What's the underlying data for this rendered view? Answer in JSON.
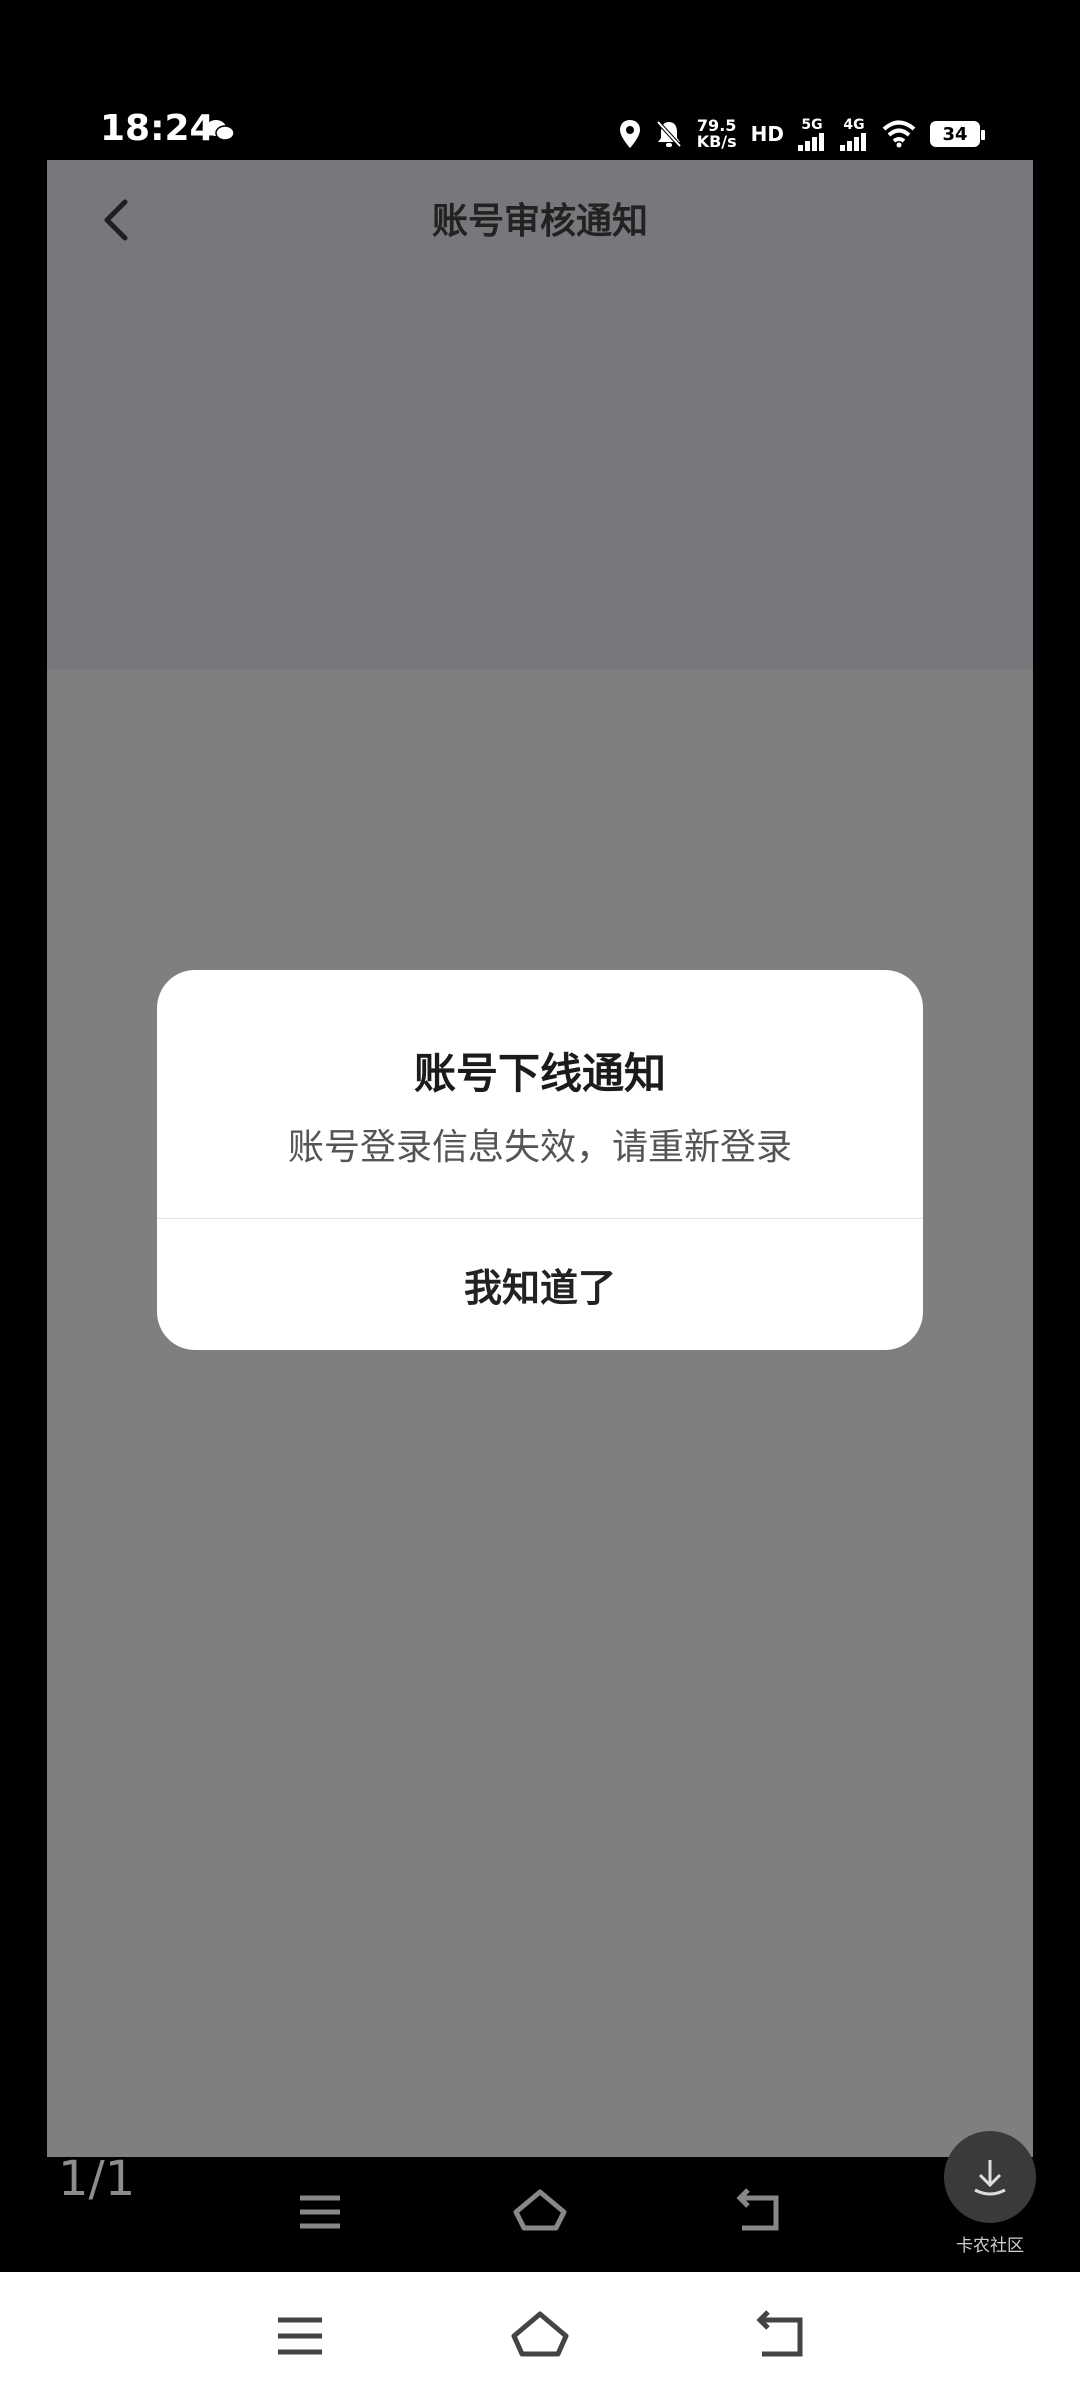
{
  "status_bar": {
    "time": "18:24",
    "net_speed_value": "79.5",
    "net_speed_unit": "KB/s",
    "hd_label": "HD",
    "sim1_label": "5G",
    "sim2_label": "4G",
    "battery": "34",
    "icons": [
      "wechat-icon",
      "location-icon",
      "mute-icon",
      "signal-icon",
      "wifi-icon",
      "battery-icon"
    ]
  },
  "header": {
    "title": "账号审核通知",
    "back_icon": "chevron-left-icon"
  },
  "dialog": {
    "title": "账号下线通知",
    "message": "账号登录信息失效，请重新登录",
    "confirm_label": "我知道了"
  },
  "viewer": {
    "page_counter": "1/1",
    "download_label": "卡农社区",
    "download_icon": "download-icon"
  },
  "colors": {
    "overlay": "#7f7f7f",
    "dialog_bg": "#ffffff",
    "text_primary": "#1b1b1b"
  }
}
